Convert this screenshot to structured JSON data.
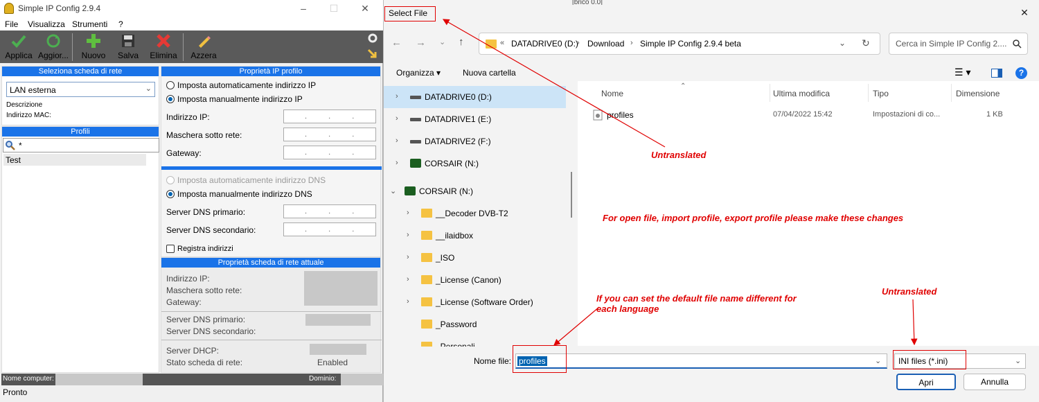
{
  "app": {
    "title": "Simple IP Config 2.9.4",
    "menu": [
      "File",
      "Visualizza",
      "Strumenti",
      "?"
    ],
    "toolbar": [
      "Applica",
      "Aggior...",
      "Nuovo",
      "Salva",
      "Elimina",
      "Azzera"
    ],
    "adapter_panel": {
      "header": "Seleziona scheda di rete",
      "selected": "LAN esterna",
      "description_label": "Descrizione",
      "mac_label": "Indirizzo MAC:"
    },
    "profiles_panel": {
      "header": "Profili",
      "filter": "*",
      "items": [
        "Test"
      ]
    },
    "ip_props": {
      "header": "Proprietà IP profilo",
      "auto_ip": "Imposta automaticamente indirizzo IP",
      "manual_ip": "Imposta manualmente indirizzo IP",
      "ip_label": "Indirizzo IP:",
      "mask_label": "Maschera sotto rete:",
      "gateway_label": "Gateway:",
      "auto_dns": "Imposta automaticamente indirizzo DNS",
      "manual_dns": "Imposta manualmente indirizzo DNS",
      "dns1_label": "Server DNS primario:",
      "dns2_label": "Server DNS secondario:",
      "register": "Registra indirizzi",
      "ip_placeholder": ".  .  ."
    },
    "current_props": {
      "header": "Proprietà scheda di rete attuale",
      "ip_label": "Indirizzo IP:",
      "mask_label": "Maschera sotto rete:",
      "gateway_label": "Gateway:",
      "dns1_label": "Server DNS primario:",
      "dns2_label": "Server DNS secondario:",
      "dhcp_label": "Server DHCP:",
      "status_label": "Stato scheda di rete:",
      "status_value": "Enabled"
    },
    "statusbar": {
      "computer_label": "Nome computer:",
      "domain_label": "Dominio:",
      "state": "Pronto"
    }
  },
  "dialog": {
    "title": "Select File",
    "breadcrumb": [
      "«",
      "DATADRIVE0 (D:)",
      "Download",
      "Simple IP Config 2.9.4 beta"
    ],
    "search_placeholder": "Cerca in Simple IP Config 2....",
    "commands": [
      "Organizza ▾",
      "Nuova cartella"
    ],
    "tree": [
      {
        "label": "DATADRIVE0 (D:)",
        "icon": "drive-icon",
        "expanded": false,
        "selected": true
      },
      {
        "label": "DATADRIVE1 (E:)",
        "icon": "drive-icon",
        "expanded": false
      },
      {
        "label": "DATADRIVE2 (F:)",
        "icon": "drive-icon",
        "expanded": false
      },
      {
        "label": "CORSAIR (N:)",
        "icon": "usb-drive-icon",
        "expanded": false
      },
      {
        "label": "CORSAIR (N:)",
        "icon": "usb-drive-icon",
        "expanded": true
      },
      {
        "label": "__Decoder DVB-T2",
        "icon": "folder-icon",
        "child": true
      },
      {
        "label": "__ilaidbox",
        "icon": "folder-icon",
        "child": true
      },
      {
        "label": "_ISO",
        "icon": "folder-icon",
        "child": true
      },
      {
        "label": "_License (Canon)",
        "icon": "folder-icon",
        "child": true
      },
      {
        "label": "_License (Software Order)",
        "icon": "folder-icon",
        "child": true
      },
      {
        "label": "_Password",
        "icon": "folder-icon",
        "child": true,
        "no_chevron": true
      },
      {
        "label": "_Personali",
        "icon": "folder-icon",
        "child": true,
        "no_chevron": true
      }
    ],
    "columns": [
      "Nome",
      "Ultima modifica",
      "Tipo",
      "Dimensione"
    ],
    "files": [
      {
        "name": "profiles",
        "modified": "07/04/2022 15:42",
        "type": "Impostazioni di co...",
        "size": "1 KB"
      }
    ],
    "filename_label": "Nome file:",
    "filename_value": "profiles",
    "filetype": "INI files (*.ini)",
    "open_button": "Apri",
    "cancel_button": "Annulla"
  },
  "annotations": {
    "untranslated_1": "Untranslated",
    "instruction": "For open file, import profile, export profile please make these changes",
    "default_name": "If you can set the default file name different for each language",
    "untranslated_2": "Untranslated",
    "color": "#e00000"
  },
  "background_window": {
    "fragment": "[brico 0.0]"
  }
}
